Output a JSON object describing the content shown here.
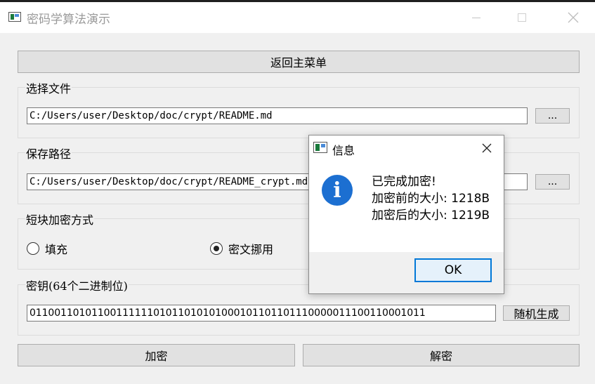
{
  "window": {
    "title": "密码学算法演示",
    "icon": "app-window-icon"
  },
  "toolbar": {
    "back_label": "返回主菜单"
  },
  "select_file": {
    "label": "选择文件",
    "value": "C:/Users/user/Desktop/doc/crypt/README.md",
    "browse_label": "..."
  },
  "save_path": {
    "label": "保存路径",
    "value": "C:/Users/user/Desktop/doc/crypt/README_crypt.md",
    "browse_label": "..."
  },
  "padding_mode": {
    "label": "短块加密方式",
    "options": [
      {
        "label": "填充",
        "selected": false
      },
      {
        "label": "密文挪用",
        "selected": true
      }
    ]
  },
  "key": {
    "label": "密钥(64个二进制位)",
    "value": "0110011010110011111101011010101000101101101110000011100110001011",
    "generate_label": "随机生成"
  },
  "actions": {
    "encrypt_label": "加密",
    "decrypt_label": "解密"
  },
  "dialog": {
    "title": "信息",
    "icon": "info-icon",
    "lines": [
      "已完成加密!",
      "加密前的大小: 1218B",
      "加密后的大小: 1219B"
    ],
    "ok_label": "OK",
    "accent": "#0078d7"
  }
}
